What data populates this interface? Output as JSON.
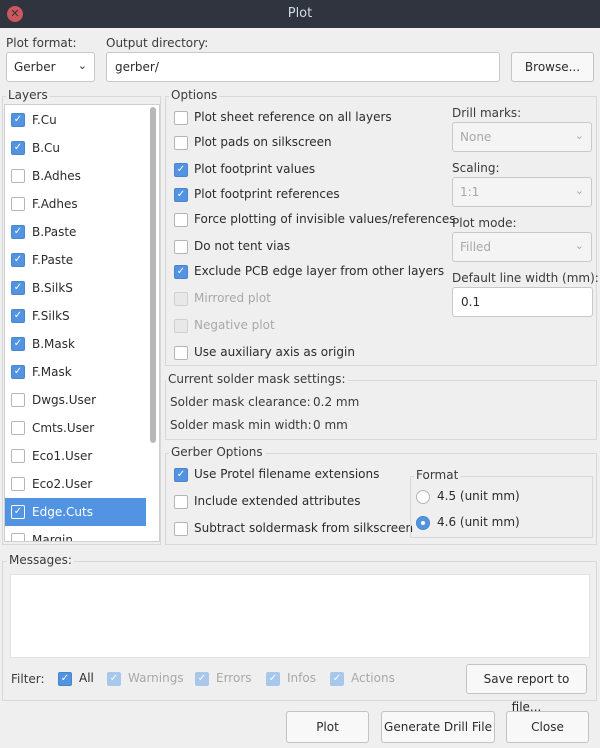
{
  "window": {
    "title": "Plot",
    "close_glyph": "✕"
  },
  "plot_format": {
    "label": "Plot format:",
    "value": "Gerber"
  },
  "output_dir": {
    "label": "Output directory:",
    "value": "gerber/",
    "browse": "Browse..."
  },
  "layers": {
    "title": "Layers",
    "items": [
      {
        "label": "F.Cu",
        "checked": true
      },
      {
        "label": "B.Cu",
        "checked": true
      },
      {
        "label": "B.Adhes",
        "checked": false
      },
      {
        "label": "F.Adhes",
        "checked": false
      },
      {
        "label": "B.Paste",
        "checked": true
      },
      {
        "label": "F.Paste",
        "checked": true
      },
      {
        "label": "B.SilkS",
        "checked": true
      },
      {
        "label": "F.SilkS",
        "checked": true
      },
      {
        "label": "B.Mask",
        "checked": true
      },
      {
        "label": "F.Mask",
        "checked": true
      },
      {
        "label": "Dwgs.User",
        "checked": false
      },
      {
        "label": "Cmts.User",
        "checked": false
      },
      {
        "label": "Eco1.User",
        "checked": false
      },
      {
        "label": "Eco2.User",
        "checked": false
      },
      {
        "label": "Edge.Cuts",
        "checked": true,
        "selected": true
      },
      {
        "label": "Margin",
        "checked": false
      }
    ]
  },
  "options": {
    "title": "Options",
    "items": [
      {
        "label": "Plot sheet reference on all layers",
        "checked": false,
        "enabled": true
      },
      {
        "label": "Plot pads on silkscreen",
        "checked": false,
        "enabled": true
      },
      {
        "label": "Plot footprint values",
        "checked": true,
        "enabled": true
      },
      {
        "label": "Plot footprint references",
        "checked": true,
        "enabled": true
      },
      {
        "label": "Force plotting of invisible values/references",
        "checked": false,
        "enabled": true
      },
      {
        "label": "Do not tent vias",
        "checked": false,
        "enabled": true
      },
      {
        "label": "Exclude PCB edge layer from other layers",
        "checked": true,
        "enabled": true
      },
      {
        "label": "Mirrored plot",
        "checked": false,
        "enabled": false
      },
      {
        "label": "Negative plot",
        "checked": false,
        "enabled": false
      },
      {
        "label": "Use auxiliary axis as origin",
        "checked": false,
        "enabled": true
      }
    ],
    "drill_marks": {
      "label": "Drill marks:",
      "value": "None"
    },
    "scaling": {
      "label": "Scaling:",
      "value": "1:1"
    },
    "plot_mode": {
      "label": "Plot mode:",
      "value": "Filled"
    },
    "line_width": {
      "label": "Default line width (mm):",
      "value": "0.1"
    }
  },
  "solder_mask": {
    "title": "Current solder mask settings:",
    "clearance_label": "Solder mask clearance:",
    "clearance_value": "0.2 mm",
    "min_width_label": "Solder mask min width:",
    "min_width_value": "0 mm"
  },
  "gerber": {
    "title": "Gerber Options",
    "items": [
      {
        "label": "Use Protel filename extensions",
        "checked": true
      },
      {
        "label": "Include extended attributes",
        "checked": false
      },
      {
        "label": "Subtract soldermask from silkscreen",
        "checked": false
      }
    ],
    "format": {
      "title": "Format",
      "options": [
        {
          "label": "4.5 (unit mm)",
          "selected": false
        },
        {
          "label": "4.6 (unit mm)",
          "selected": true
        }
      ]
    }
  },
  "messages": {
    "title": "Messages:",
    "filter_label": "Filter:",
    "filters": [
      {
        "label": "All",
        "checked": true,
        "enabled": true
      },
      {
        "label": "Warnings",
        "checked": true,
        "enabled": false
      },
      {
        "label": "Errors",
        "checked": true,
        "enabled": false
      },
      {
        "label": "Infos",
        "checked": true,
        "enabled": false
      },
      {
        "label": "Actions",
        "checked": true,
        "enabled": false
      }
    ],
    "save_report": "Save report to file..."
  },
  "buttons": {
    "plot": "Plot",
    "drill": "Generate Drill File",
    "close": "Close"
  },
  "colors": {
    "accent": "#5294e2",
    "titlebar": "#2f343f",
    "close": "#cc575d"
  }
}
